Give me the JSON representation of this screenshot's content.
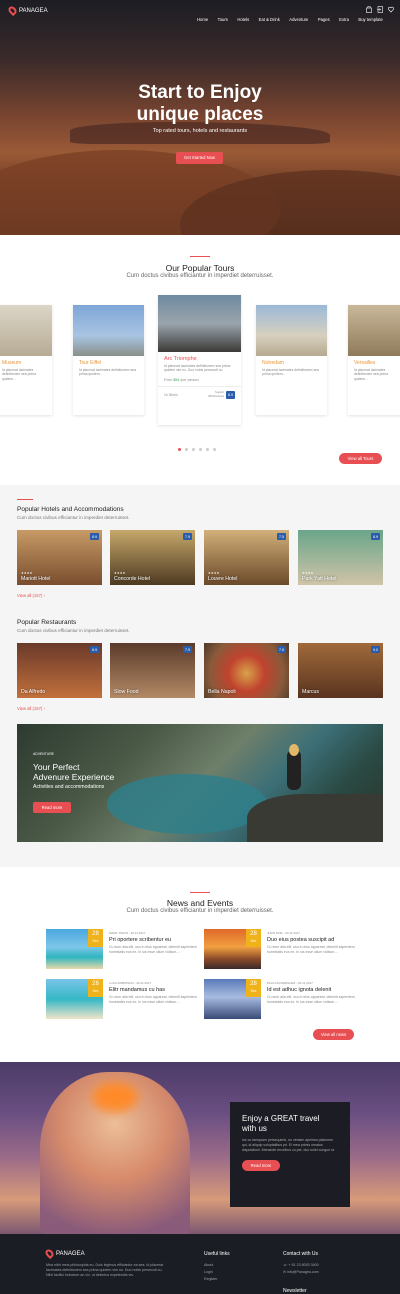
{
  "header": {
    "brand": "PANAGEA",
    "nav": [
      "Home",
      "Tours",
      "Hotels",
      "Eat & Drink",
      "Adventure",
      "Pages",
      "Extra",
      "Buy template"
    ]
  },
  "hero": {
    "title_line1": "Start to Enjoy",
    "title_line2": "unique places",
    "subtitle": "Top rated tours, hotels and restaurants",
    "cta": "Get Started Now"
  },
  "tours": {
    "title": "Our Popular Tours",
    "subtitle": "Cum doctus civibus efficiantur in imperdiet deterruisset.",
    "cards": [
      {
        "badge": "",
        "name": "Museum",
        "desc": "Id placerat tacimates definitionem sea prima quidem..."
      },
      {
        "badge": "HISTORIC",
        "name": "Tour Eiffel",
        "desc": "Id placerat tacimates definitionem sea prima quidem..."
      },
      {
        "badge": "HISTORIC",
        "name": "Arc Triomphe",
        "desc": "Id placerat tacimates definitionem sea prima quidem vim no. Duo nobis persecuti cu.",
        "price_label": "From",
        "price": "$54",
        "per": "/per person",
        "duration": "1h 30min",
        "review": "Superb",
        "reviews_count": "350 Reviews",
        "score": "8.9"
      },
      {
        "badge": "CHURCHES",
        "name": "Notredam",
        "desc": "Id placerat tacimates definitionem sea prima quidem..."
      },
      {
        "badge": "",
        "name": "Versailles",
        "desc": "Id placerat tacimates definitionem sea prima quidem..."
      }
    ],
    "view_all": "View all Tours"
  },
  "hotels": {
    "title": "Popular Hotels and Accommodations",
    "subtitle": "Cum doctus civibus efficiantur in imperdiet deterruisset.",
    "items": [
      {
        "name": "Mariott Hotel",
        "rating": "8.9"
      },
      {
        "name": "Concorde Hotel",
        "rating": "7.9"
      },
      {
        "name": "Louvre Hotel",
        "rating": "7.5"
      },
      {
        "name": "Park Yatt Hotel",
        "rating": "8.9"
      }
    ],
    "view_all": "View all (157)"
  },
  "restaurants": {
    "title": "Popular Restaurants",
    "subtitle": "Cum doctus civibus efficiantur in imperdiet deterruisset.",
    "items": [
      {
        "name": "Da Alfredo",
        "rating": "8.9"
      },
      {
        "name": "Slow Food",
        "rating": "7.9"
      },
      {
        "name": "Bella Napoli",
        "rating": "7.5"
      },
      {
        "name": "Marcus",
        "rating": "9.0"
      }
    ],
    "view_all": "View all (157)"
  },
  "adventure": {
    "kicker": "ADVENTURE",
    "title_line1": "Your Perfect",
    "title_line2": "Advenure Experience",
    "subtitle": "Activities and accommodations",
    "cta": "Read more"
  },
  "news": {
    "title": "News and Events",
    "subtitle": "Cum doctus civibus efficiantur in imperdiet deterruisset.",
    "items": [
      {
        "day": "28",
        "month": "Dec",
        "meta": "MARK TWAIN - 20.11.2017",
        "title": "Pri oportere scribentur eu",
        "desc": "Cu eum alia elit, usu in eius appareat, deleniti sapientem honestatis eos ex. In ius esse ullum vidisse...."
      },
      {
        "day": "28",
        "month": "Dec",
        "meta": "JHON DOE - 20.11.2017",
        "title": "Duo eius postea suscipit ad",
        "desc": "Cu eum alia elit, usu in eius appareat, deleniti sapientem honestatis eos ex. In ius esse ullum vidisse...."
      },
      {
        "day": "28",
        "month": "Dec",
        "meta": "LUCA ROBINSON - 20.11.2017",
        "title": "Elitr mandamus cu has",
        "desc": "Cu eum alia elit, usu in eius appareat, deleniti sapientem honestatis eos ex. In ius esse ullum vidisse...."
      },
      {
        "day": "28",
        "month": "Dec",
        "meta": "PAULA RODRIGUEZ - 20.11.2017",
        "title": "Id est adhuc ignota delenit",
        "desc": "Cu eum alia elit, usu in eius appareat, deleniti sapientem honestatis eos ex. In ius esse ullum vidisse...."
      }
    ],
    "view_all": "View all news"
  },
  "promo": {
    "title_line1": "Enjoy a GREAT travel",
    "title_line2": "with us",
    "text": "Ius cu tamquam persequeris, eu veniam apeirian platonem qui, id aliquip voluptatibus pri. Ei mea primis ornatus disputationi. Menandri erroribus cu per, duo solet congue ut.",
    "cta": "Read more"
  },
  "footer": {
    "brand": "PANAGEA",
    "about": "Mea nibh meis philosophia eu. Duis legimus efficiantur ea sea. Id placerat tacimates definitionem sea prima quidem vim no. Duo nobis persecuti cu. Nihil facilisi indoctum an vix, ut delectus expetendis vis.",
    "useful_title": "Useful links",
    "useful_links": [
      "About",
      "Login",
      "Register"
    ],
    "contact_title": "Contact with Us",
    "phone": "+ 61 23 8093 3400",
    "email": "info@Panagea.com",
    "newsletter": "Newsletter"
  },
  "colors": {
    "accent": "#e84f52",
    "rating_blue": "#2a5caa",
    "date_yellow": "#f0b21a",
    "footer_bg": "#1b1d24"
  }
}
